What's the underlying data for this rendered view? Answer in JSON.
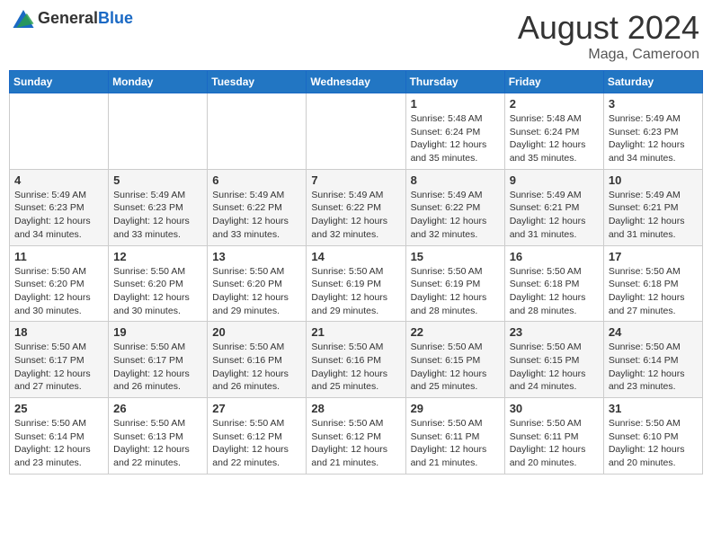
{
  "logo": {
    "general": "General",
    "blue": "Blue"
  },
  "title": "August 2024",
  "subtitle": "Maga, Cameroon",
  "weekdays": [
    "Sunday",
    "Monday",
    "Tuesday",
    "Wednesday",
    "Thursday",
    "Friday",
    "Saturday"
  ],
  "weeks": [
    [
      {
        "day": "",
        "info": ""
      },
      {
        "day": "",
        "info": ""
      },
      {
        "day": "",
        "info": ""
      },
      {
        "day": "",
        "info": ""
      },
      {
        "day": "1",
        "info": "Sunrise: 5:48 AM\nSunset: 6:24 PM\nDaylight: 12 hours\nand 35 minutes."
      },
      {
        "day": "2",
        "info": "Sunrise: 5:48 AM\nSunset: 6:24 PM\nDaylight: 12 hours\nand 35 minutes."
      },
      {
        "day": "3",
        "info": "Sunrise: 5:49 AM\nSunset: 6:23 PM\nDaylight: 12 hours\nand 34 minutes."
      }
    ],
    [
      {
        "day": "4",
        "info": "Sunrise: 5:49 AM\nSunset: 6:23 PM\nDaylight: 12 hours\nand 34 minutes."
      },
      {
        "day": "5",
        "info": "Sunrise: 5:49 AM\nSunset: 6:23 PM\nDaylight: 12 hours\nand 33 minutes."
      },
      {
        "day": "6",
        "info": "Sunrise: 5:49 AM\nSunset: 6:22 PM\nDaylight: 12 hours\nand 33 minutes."
      },
      {
        "day": "7",
        "info": "Sunrise: 5:49 AM\nSunset: 6:22 PM\nDaylight: 12 hours\nand 32 minutes."
      },
      {
        "day": "8",
        "info": "Sunrise: 5:49 AM\nSunset: 6:22 PM\nDaylight: 12 hours\nand 32 minutes."
      },
      {
        "day": "9",
        "info": "Sunrise: 5:49 AM\nSunset: 6:21 PM\nDaylight: 12 hours\nand 31 minutes."
      },
      {
        "day": "10",
        "info": "Sunrise: 5:49 AM\nSunset: 6:21 PM\nDaylight: 12 hours\nand 31 minutes."
      }
    ],
    [
      {
        "day": "11",
        "info": "Sunrise: 5:50 AM\nSunset: 6:20 PM\nDaylight: 12 hours\nand 30 minutes."
      },
      {
        "day": "12",
        "info": "Sunrise: 5:50 AM\nSunset: 6:20 PM\nDaylight: 12 hours\nand 30 minutes."
      },
      {
        "day": "13",
        "info": "Sunrise: 5:50 AM\nSunset: 6:20 PM\nDaylight: 12 hours\nand 29 minutes."
      },
      {
        "day": "14",
        "info": "Sunrise: 5:50 AM\nSunset: 6:19 PM\nDaylight: 12 hours\nand 29 minutes."
      },
      {
        "day": "15",
        "info": "Sunrise: 5:50 AM\nSunset: 6:19 PM\nDaylight: 12 hours\nand 28 minutes."
      },
      {
        "day": "16",
        "info": "Sunrise: 5:50 AM\nSunset: 6:18 PM\nDaylight: 12 hours\nand 28 minutes."
      },
      {
        "day": "17",
        "info": "Sunrise: 5:50 AM\nSunset: 6:18 PM\nDaylight: 12 hours\nand 27 minutes."
      }
    ],
    [
      {
        "day": "18",
        "info": "Sunrise: 5:50 AM\nSunset: 6:17 PM\nDaylight: 12 hours\nand 27 minutes."
      },
      {
        "day": "19",
        "info": "Sunrise: 5:50 AM\nSunset: 6:17 PM\nDaylight: 12 hours\nand 26 minutes."
      },
      {
        "day": "20",
        "info": "Sunrise: 5:50 AM\nSunset: 6:16 PM\nDaylight: 12 hours\nand 26 minutes."
      },
      {
        "day": "21",
        "info": "Sunrise: 5:50 AM\nSunset: 6:16 PM\nDaylight: 12 hours\nand 25 minutes."
      },
      {
        "day": "22",
        "info": "Sunrise: 5:50 AM\nSunset: 6:15 PM\nDaylight: 12 hours\nand 25 minutes."
      },
      {
        "day": "23",
        "info": "Sunrise: 5:50 AM\nSunset: 6:15 PM\nDaylight: 12 hours\nand 24 minutes."
      },
      {
        "day": "24",
        "info": "Sunrise: 5:50 AM\nSunset: 6:14 PM\nDaylight: 12 hours\nand 23 minutes."
      }
    ],
    [
      {
        "day": "25",
        "info": "Sunrise: 5:50 AM\nSunset: 6:14 PM\nDaylight: 12 hours\nand 23 minutes."
      },
      {
        "day": "26",
        "info": "Sunrise: 5:50 AM\nSunset: 6:13 PM\nDaylight: 12 hours\nand 22 minutes."
      },
      {
        "day": "27",
        "info": "Sunrise: 5:50 AM\nSunset: 6:12 PM\nDaylight: 12 hours\nand 22 minutes."
      },
      {
        "day": "28",
        "info": "Sunrise: 5:50 AM\nSunset: 6:12 PM\nDaylight: 12 hours\nand 21 minutes."
      },
      {
        "day": "29",
        "info": "Sunrise: 5:50 AM\nSunset: 6:11 PM\nDaylight: 12 hours\nand 21 minutes."
      },
      {
        "day": "30",
        "info": "Sunrise: 5:50 AM\nSunset: 6:11 PM\nDaylight: 12 hours\nand 20 minutes."
      },
      {
        "day": "31",
        "info": "Sunrise: 5:50 AM\nSunset: 6:10 PM\nDaylight: 12 hours\nand 20 minutes."
      }
    ]
  ]
}
